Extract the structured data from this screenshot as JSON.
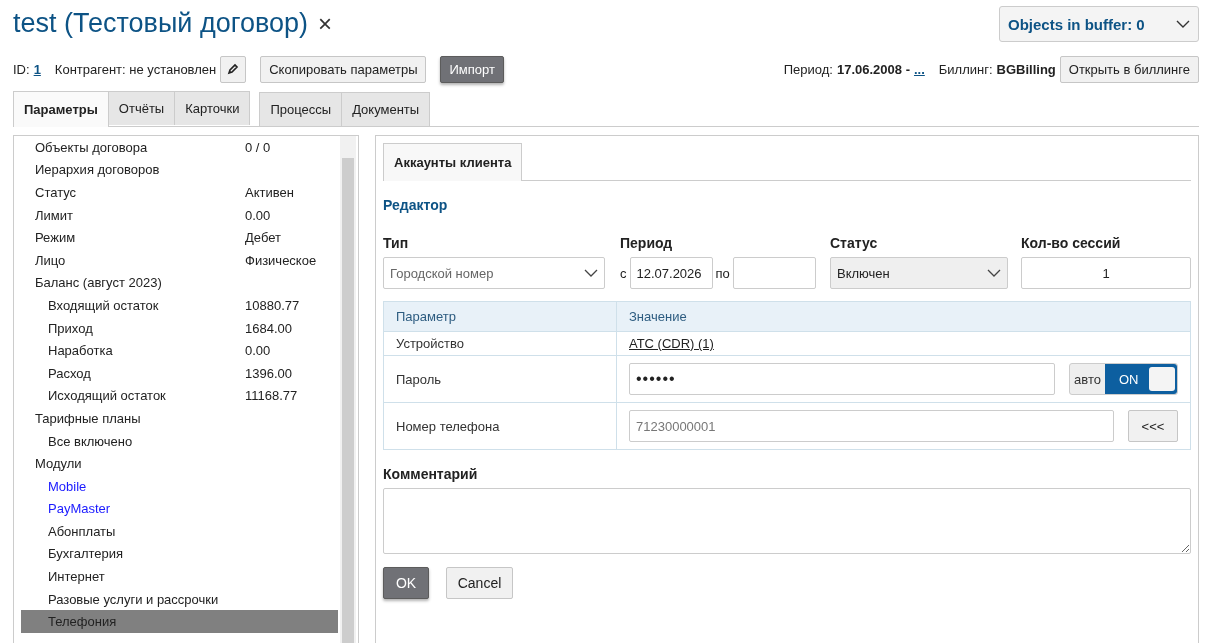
{
  "title": "test (Тестовый договор)",
  "close_icon": "×",
  "buffer": {
    "label": "Objects in buffer: 0"
  },
  "info": {
    "id_label": "ID:",
    "id": "1",
    "contractor": "Контрагент: не установлен",
    "period_label": "Период:",
    "period": "17.06.2008 -",
    "period_link": "...",
    "billing_label": "Биллинг:",
    "billing": "BGBilling"
  },
  "buttons": {
    "copy": "Скопировать параметры",
    "import": "Импорт",
    "open": "Открыть в биллинге"
  },
  "tab_groups": [
    {
      "tabs": [
        {
          "label": "Параметры",
          "selected": true
        },
        {
          "label": "Отчёты",
          "selected": false
        },
        {
          "label": "Карточки",
          "selected": false
        }
      ]
    },
    {
      "tabs": [
        {
          "label": "Процессы",
          "selected": false
        },
        {
          "label": "Документы",
          "selected": false
        }
      ]
    }
  ],
  "tree": [
    {
      "label": "Объекты договора",
      "value": "0 / 0",
      "kind": "text",
      "selected": false
    },
    {
      "label": "Иерархия договоров",
      "kind": "text",
      "selected": false
    },
    {
      "label": "Статус",
      "value": "Активен",
      "kind": "text",
      "selected": false
    },
    {
      "label": "Лимит",
      "value": "0.00",
      "kind": "text",
      "selected": false
    },
    {
      "label": "Режим",
      "value": "Дебет",
      "kind": "text",
      "selected": false
    },
    {
      "label": "Лицо",
      "value": "Физическое",
      "kind": "text",
      "selected": false
    },
    {
      "label": "Баланс (август 2023)",
      "kind": "text",
      "selected": false,
      "children": [
        {
          "label": "Входящий остаток",
          "value": "10880.77",
          "kind": "text",
          "selected": false
        },
        {
          "label": "Приход",
          "value": "1684.00",
          "kind": "text",
          "selected": false
        },
        {
          "label": "Наработка",
          "value": "0.00",
          "kind": "text",
          "selected": false
        },
        {
          "label": "Расход",
          "value": "1396.00",
          "kind": "text",
          "selected": false
        },
        {
          "label": "Исходящий остаток",
          "value": "11168.77",
          "kind": "text",
          "selected": false
        }
      ]
    },
    {
      "label": "Тарифные планы",
      "kind": "text",
      "selected": false,
      "children": [
        {
          "label": "Все включено",
          "kind": "text",
          "selected": false
        }
      ]
    },
    {
      "label": "Модули",
      "kind": "text",
      "selected": false,
      "children": [
        {
          "label": "Mobile",
          "kind": "link",
          "selected": false
        },
        {
          "label": "PayMaster",
          "kind": "link",
          "selected": false
        },
        {
          "label": "Абонплаты",
          "kind": "text",
          "selected": false
        },
        {
          "label": "Бухгалтерия",
          "kind": "text",
          "selected": false
        },
        {
          "label": "Интернет",
          "kind": "text",
          "selected": false
        },
        {
          "label": "Разовые услуги и рассрочки",
          "kind": "text",
          "selected": false
        },
        {
          "label": "Телефония",
          "kind": "text",
          "selected": true
        }
      ]
    }
  ],
  "inner_tab": {
    "label": "Аккаунты клиента",
    "selected": true
  },
  "editor": {
    "heading": "Редактор",
    "type": {
      "label": "Тип",
      "placeholder": "Городской номер"
    },
    "period": {
      "label": "Период",
      "from_label": "с",
      "from": "12.07.2026",
      "to_label": "по"
    },
    "status": {
      "label": "Статус",
      "value": "Включен"
    },
    "sessions": {
      "label": "Кол-во сессий",
      "value": "1"
    },
    "table": {
      "columns": [
        "Параметр",
        "Значение"
      ],
      "rows": [
        {
          "kind": "link",
          "name": "Устройство",
          "value": "АТС (CDR) (1)"
        },
        {
          "kind": "password",
          "name": "Пароль",
          "value": "••••••",
          "toggle_label": "авто",
          "toggle": {
            "label": "ON",
            "on": true
          }
        },
        {
          "kind": "phone",
          "name": "Номер телефона",
          "placeholder": "71230000001",
          "button": "<<<"
        }
      ]
    },
    "comment_label": "Комментарий",
    "ok": "OK",
    "cancel": "Cancel"
  }
}
